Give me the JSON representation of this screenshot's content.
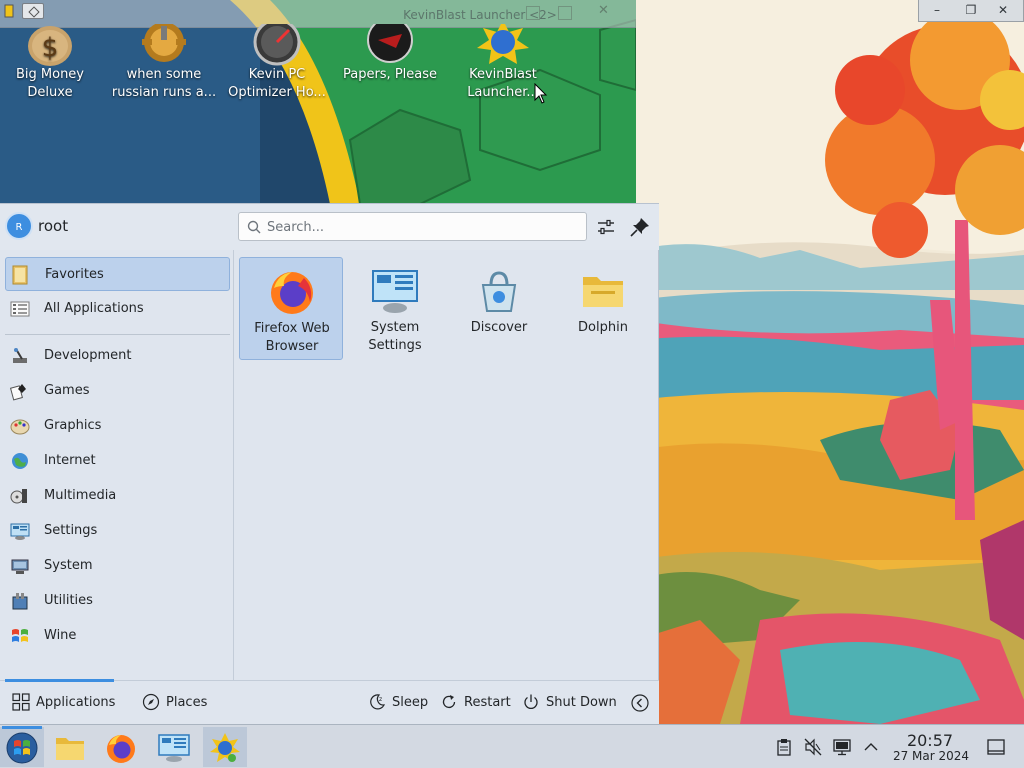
{
  "background_window": {
    "title": "KevinBlast Launcher <2>",
    "desktop_icons": [
      {
        "icon": "money-bag-icon",
        "label_line1": "Big Money",
        "label_line2": "Deluxe"
      },
      {
        "icon": "gear-icon",
        "label_line1": "when some",
        "label_line2": "russian runs a..."
      },
      {
        "icon": "speedometer-icon",
        "label_line1": "Kevin PC",
        "label_line2": "Optimizer Ho..."
      },
      {
        "icon": "papers-please-icon",
        "label_line1": "Papers, Please",
        "label_line2": ""
      },
      {
        "icon": "kevinblast-icon",
        "label_line1": "KevinBlast",
        "label_line2": "Launcher..."
      }
    ]
  },
  "window_controls": {
    "minimize": "–",
    "maximize": "❐",
    "close": "✕"
  },
  "launcher": {
    "user": {
      "initial": "R",
      "name": "root"
    },
    "search": {
      "placeholder": "Search...",
      "value": ""
    },
    "categories": [
      {
        "label": "Favorites",
        "icon": "favorites-icon",
        "selected": true
      },
      {
        "label": "All Applications",
        "icon": "all-applications-icon",
        "selected": false
      },
      {
        "label": "Development",
        "icon": "development-icon",
        "selected": false
      },
      {
        "label": "Games",
        "icon": "games-icon",
        "selected": false
      },
      {
        "label": "Graphics",
        "icon": "graphics-icon",
        "selected": false
      },
      {
        "label": "Internet",
        "icon": "internet-icon",
        "selected": false
      },
      {
        "label": "Multimedia",
        "icon": "multimedia-icon",
        "selected": false
      },
      {
        "label": "Settings",
        "icon": "settings-icon",
        "selected": false
      },
      {
        "label": "System",
        "icon": "system-icon",
        "selected": false
      },
      {
        "label": "Utilities",
        "icon": "utilities-icon",
        "selected": false
      },
      {
        "label": "Wine",
        "icon": "wine-icon",
        "selected": false
      }
    ],
    "favorites": [
      {
        "line1": "Firefox Web",
        "line2": "Browser",
        "icon": "firefox-icon",
        "selected": true
      },
      {
        "line1": "System",
        "line2": "Settings",
        "icon": "system-settings-icon",
        "selected": false
      },
      {
        "line1": "Discover",
        "line2": "",
        "icon": "discover-icon",
        "selected": false
      },
      {
        "line1": "Dolphin",
        "line2": "",
        "icon": "dolphin-icon",
        "selected": false
      }
    ],
    "footer": {
      "applications": "Applications",
      "places": "Places",
      "sleep": "Sleep",
      "restart": "Restart",
      "shutdown": "Shut Down"
    }
  },
  "taskbar": {
    "tasks": [
      {
        "icon": "start-menu-icon",
        "active": true
      },
      {
        "icon": "dolphin-icon",
        "active": false
      },
      {
        "icon": "firefox-icon",
        "active": false
      },
      {
        "icon": "system-settings-icon",
        "active": false
      },
      {
        "icon": "kevinblast-icon",
        "active": true
      }
    ],
    "tray": [
      "clipboard-icon",
      "volume-muted-icon",
      "network-icon",
      "expand-tray-icon"
    ],
    "clock": {
      "time": "20:57",
      "date": "27 Mar 2024"
    }
  },
  "colors": {
    "accent": "#3d8ee0",
    "selection": "#bcd1ec",
    "panel": "#dfe5ee",
    "taskbar": "#d3d9e2"
  }
}
